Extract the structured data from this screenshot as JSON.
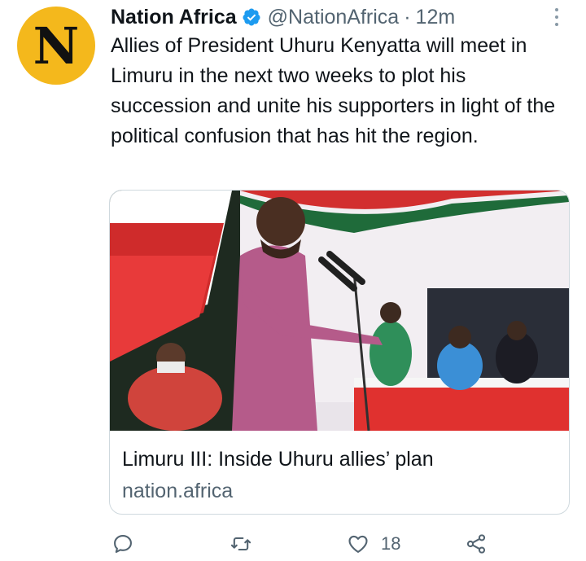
{
  "tweet": {
    "avatar_letter": "N",
    "author_name": "Nation Africa",
    "handle": "@NationAfrica",
    "separator": "·",
    "time": "12m",
    "text": "Allies of President Uhuru Kenyatta will meet in Limuru in the next two weeks to plot his succession and unite his supporters in light of the political confusion that has hit the region."
  },
  "card": {
    "title": "Limuru III: Inside Uhuru allies’ plan",
    "domain": "nation.africa"
  },
  "actions": {
    "like_count": "18"
  },
  "icons": {
    "verified": "verified-badge-icon",
    "more": "more-options-icon",
    "reply": "reply-icon",
    "retweet": "retweet-icon",
    "like": "heart-icon",
    "share": "share-icon"
  },
  "colors": {
    "avatar_bg": "#f4b81c",
    "verified": "#1d9bf0",
    "secondary_text": "#536471",
    "card_border": "#cfd9de"
  }
}
